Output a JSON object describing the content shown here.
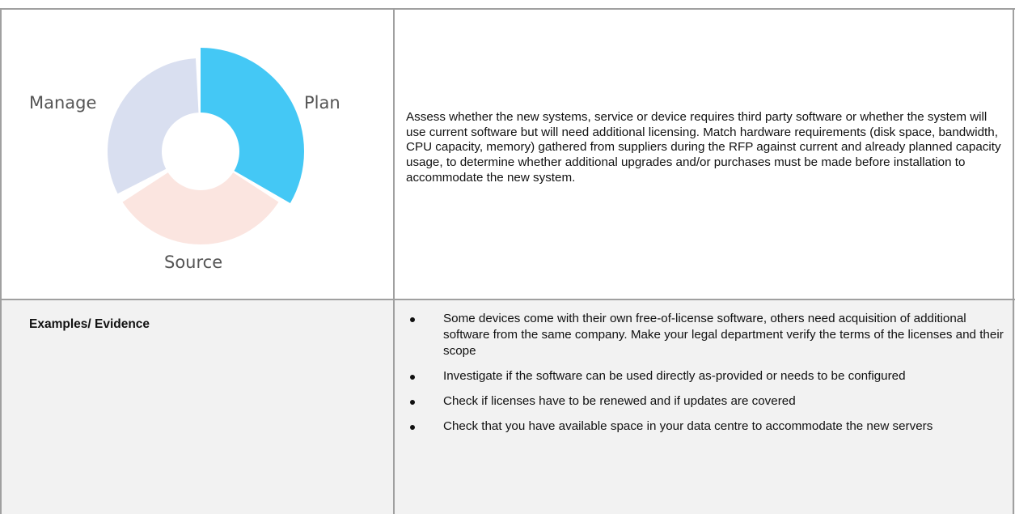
{
  "diagram": {
    "labels": {
      "manage": "Manage",
      "plan": "Plan",
      "source": "Source"
    },
    "segments": [
      {
        "name": "Plan",
        "color": "#44c8f5",
        "highlighted": true
      },
      {
        "name": "Source",
        "color": "#fbe5e0",
        "highlighted": false
      },
      {
        "name": "Manage",
        "color": "#d9dff0",
        "highlighted": false
      }
    ]
  },
  "description": "Assess whether the new systems, service or device requires third party software or whether the system will use current software but will need additional licensing. Match hardware requirements (disk space, bandwidth, CPU capacity, memory) gathered from suppliers during the RFP against current and already planned capacity usage, to determine whether additional upgrades and/or purchases must be made before installation to accommodate the new system.",
  "examples": {
    "label": "Examples/ Evidence",
    "items": [
      "Some devices come with their own free-of-license software, others need acquisition of additional software from the same company. Make your legal department verify the terms of the licenses and their scope",
      "Investigate if the software can be used directly as-provided or needs to be configured",
      "Check if licenses have to be renewed and if updates are covered",
      "Check that you have available space in your data centre to accommodate the new servers"
    ]
  }
}
